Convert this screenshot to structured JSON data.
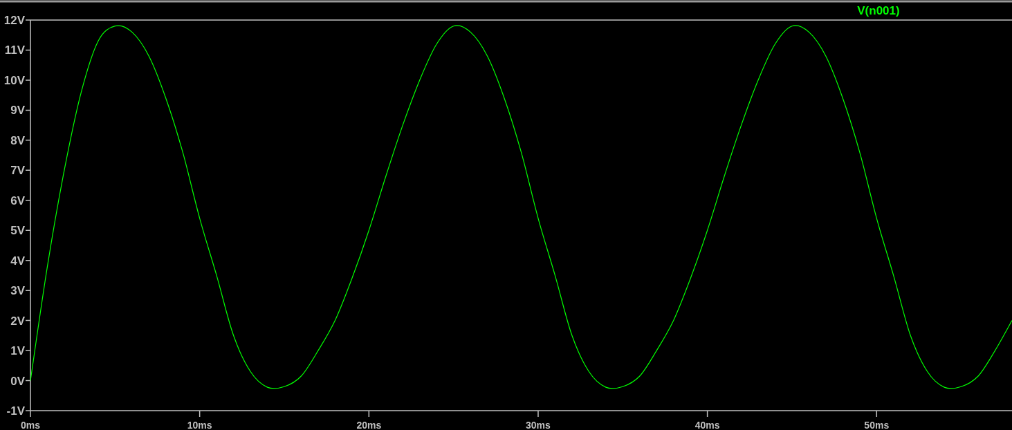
{
  "plot": {
    "chart_data": {
      "type": "line",
      "x": [
        0,
        1,
        2,
        3,
        4,
        5,
        6,
        7,
        8,
        9,
        10,
        11,
        12,
        13,
        14,
        15,
        16,
        17,
        18,
        19,
        20,
        21,
        22,
        23,
        24,
        25,
        26,
        27,
        28,
        29,
        30,
        31,
        32,
        33,
        34,
        35,
        36,
        37,
        38,
        39,
        40,
        41,
        42,
        43,
        44,
        45,
        46,
        47,
        48,
        49,
        50,
        51,
        52,
        53,
        54,
        55,
        56,
        57,
        58
      ],
      "series": [
        {
          "name": "V(n001)",
          "color": "#00ff00",
          "values": [
            0,
            3.8,
            7.0,
            9.6,
            11.3,
            11.8,
            11.6,
            10.8,
            9.4,
            7.6,
            5.4,
            3.5,
            1.5,
            0.3,
            -0.22,
            -0.2,
            0.15,
            1.0,
            2.0,
            3.4,
            5.0,
            6.8,
            8.5,
            10.0,
            11.2,
            11.8,
            11.6,
            10.8,
            9.4,
            7.6,
            5.4,
            3.5,
            1.5,
            0.3,
            -0.22,
            -0.2,
            0.15,
            1.0,
            2.0,
            3.4,
            5.0,
            6.8,
            8.5,
            10.0,
            11.2,
            11.8,
            11.6,
            10.8,
            9.4,
            7.6,
            5.4,
            3.5,
            1.5,
            0.3,
            -0.22,
            -0.2,
            0.15,
            1.0,
            2.0
          ]
        }
      ],
      "xlim": [
        0,
        58
      ],
      "ylim": [
        -1,
        12
      ],
      "xticks": [
        {
          "value": 0,
          "label": "0ms"
        },
        {
          "value": 10,
          "label": "10ms"
        },
        {
          "value": 20,
          "label": "20ms"
        },
        {
          "value": 30,
          "label": "30ms"
        },
        {
          "value": 40,
          "label": "40ms"
        },
        {
          "value": 50,
          "label": "50ms"
        }
      ],
      "yticks": [
        {
          "value": 12,
          "label": "12V"
        },
        {
          "value": 11,
          "label": "11V"
        },
        {
          "value": 10,
          "label": "10V"
        },
        {
          "value": 9,
          "label": "9V"
        },
        {
          "value": 8,
          "label": "8V"
        },
        {
          "value": 7,
          "label": "7V"
        },
        {
          "value": 6,
          "label": "6V"
        },
        {
          "value": 5,
          "label": "5V"
        },
        {
          "value": 4,
          "label": "4V"
        },
        {
          "value": 3,
          "label": "3V"
        },
        {
          "value": 2,
          "label": "2V"
        },
        {
          "value": 1,
          "label": "1V"
        },
        {
          "value": 0,
          "label": "0V"
        },
        {
          "value": -1,
          "label": "-1V"
        }
      ]
    }
  }
}
